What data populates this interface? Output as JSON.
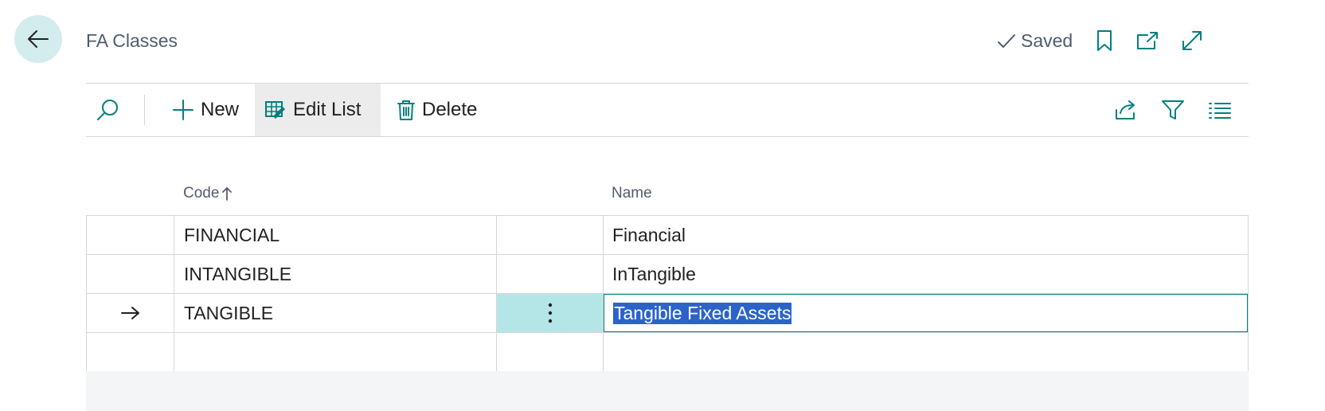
{
  "header": {
    "title": "FA Classes",
    "status": "Saved",
    "icons": [
      "back-arrow-icon",
      "checkmark-icon",
      "bookmark-icon",
      "open-in-new-window-icon",
      "expand-icon"
    ]
  },
  "actions": {
    "new_label": "New",
    "edit_list_label": "Edit List",
    "delete_label": "Delete"
  },
  "columns": {
    "code": "Code",
    "name": "Name"
  },
  "rows": [
    {
      "code": "FINANCIAL",
      "name": "Financial"
    },
    {
      "code": "INTANGIBLE",
      "name": "InTangible"
    },
    {
      "code": "TANGIBLE",
      "name": "Tangible Fixed Assets"
    },
    {
      "code": "",
      "name": ""
    }
  ],
  "colors": {
    "accent": "#00807f",
    "selection": "#2b63c8",
    "active_cell": "#b4e6e8"
  }
}
